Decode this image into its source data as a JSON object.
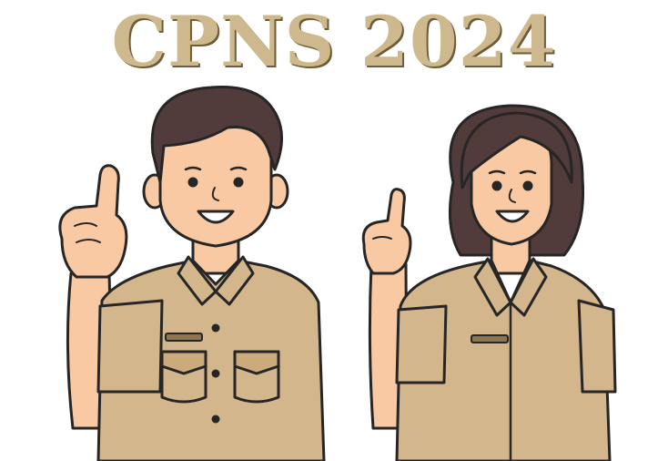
{
  "headline": {
    "text": "CPNS 2024"
  },
  "colors": {
    "headline": "#cdb98d",
    "headline_shadow": "#6f5c37",
    "skin": "#f9c9a3",
    "hair": "#523b3b",
    "uniform": "#d3b68b",
    "outline": "#262626"
  },
  "figures": [
    {
      "name": "man-figure",
      "gesture": "pointing-up"
    },
    {
      "name": "woman-figure",
      "gesture": "pointing-up"
    }
  ]
}
